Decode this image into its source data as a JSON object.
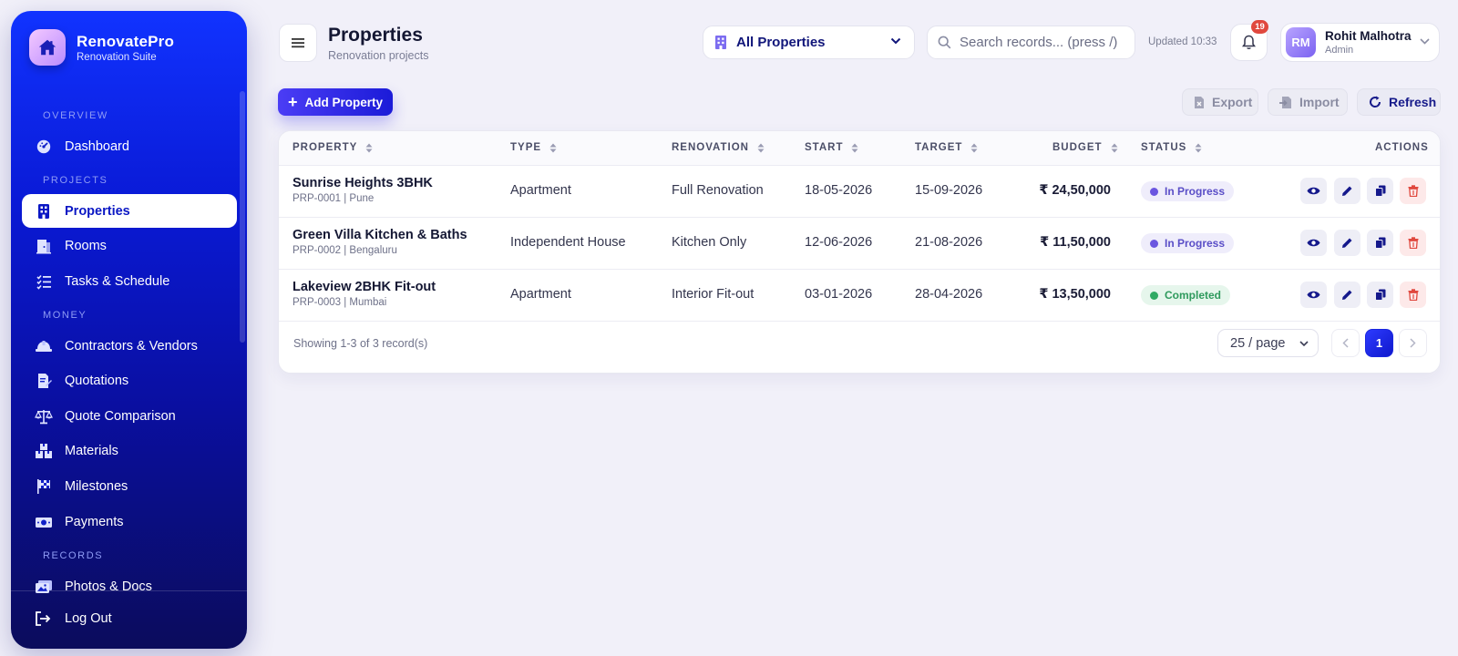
{
  "brand": {
    "name": "RenovatePro",
    "subtitle": "Renovation Suite"
  },
  "sidebar": {
    "sections": {
      "overview": "OVERVIEW",
      "projects": "PROJECTS",
      "money": "MONEY",
      "records": "RECORDS"
    },
    "items": {
      "dashboard": "Dashboard",
      "properties": "Properties",
      "rooms": "Rooms",
      "tasks": "Tasks & Schedule",
      "contractors": "Contractors & Vendors",
      "quotations": "Quotations",
      "comparison": "Quote Comparison",
      "materials": "Materials",
      "milestones": "Milestones",
      "payments": "Payments",
      "photos": "Photos & Docs"
    },
    "active": "properties",
    "logout": "Log Out"
  },
  "header": {
    "title": "Properties",
    "subtitle": "Renovation projects",
    "property_selector": "All Properties",
    "search_placeholder": "Search records... (press /)",
    "updated": "Updated 10:33",
    "notifications": "19",
    "user": {
      "initials": "RM",
      "name": "Rohit Malhotra",
      "role": "Admin"
    }
  },
  "toolbar": {
    "add": "Add Property",
    "export": "Export",
    "import": "Import",
    "refresh": "Refresh"
  },
  "table": {
    "columns": {
      "property": "PROPERTY",
      "type": "TYPE",
      "renovation": "RENOVATION",
      "start": "START",
      "target": "TARGET",
      "budget": "BUDGET",
      "status": "STATUS",
      "actions": "ACTIONS"
    },
    "rows": [
      {
        "name": "Sunrise Heights 3BHK",
        "meta": "PRP-0001 | Pune",
        "type": "Apartment",
        "renovation": "Full Renovation",
        "start": "18-05-2026",
        "target": "15-09-2026",
        "budget": "₹ 24,50,000",
        "status": "In Progress"
      },
      {
        "name": "Green Villa Kitchen & Baths",
        "meta": "PRP-0002 | Bengaluru",
        "type": "Independent House",
        "renovation": "Kitchen Only",
        "start": "12-06-2026",
        "target": "21-08-2026",
        "budget": "₹ 11,50,000",
        "status": "In Progress"
      },
      {
        "name": "Lakeview 2BHK Fit-out",
        "meta": "PRP-0003 | Mumbai",
        "type": "Apartment",
        "renovation": "Interior Fit-out",
        "start": "03-01-2026",
        "target": "28-04-2026",
        "budget": "₹ 13,50,000",
        "status": "Completed"
      }
    ],
    "footer": "Showing 1-3 of 3 record(s)",
    "per_page": "25 / page",
    "current_page": "1"
  },
  "colors": {
    "accent": "#1b1bd8",
    "in_progress": "#6b56e0",
    "completed": "#2faa63",
    "danger": "#e0483e"
  }
}
